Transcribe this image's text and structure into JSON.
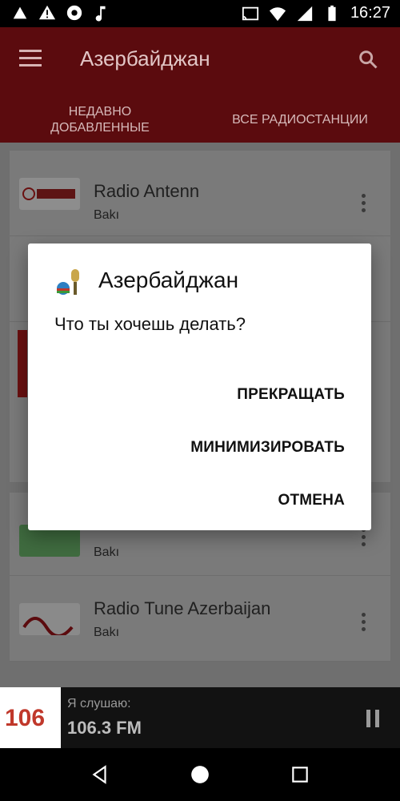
{
  "status_bar": {
    "time": "16:27",
    "icons": [
      "app-icon",
      "warning-icon",
      "aperture-icon",
      "music-note-icon",
      "cast-icon",
      "wifi-icon",
      "signal-icon",
      "battery-icon"
    ]
  },
  "app_bar": {
    "title": "Азербайджан",
    "menu_icon": "menu-icon",
    "search_icon": "search-icon",
    "colors": {
      "primary": "#5b0b0e",
      "indicator": "#7a6a1c"
    }
  },
  "tabs": [
    {
      "label": "НЕДАВНО ДОБАВЛЕННЫЕ",
      "selected": true
    },
    {
      "label": "ВСЕ РАДИОСТАНЦИИ",
      "selected": false
    }
  ],
  "stations": [
    {
      "name": "Radio Antenn",
      "city": "Bakı",
      "logo_text": "radio antenn"
    },
    {
      "name": "",
      "city": "",
      "logo_text": ""
    },
    {
      "name": "",
      "city": "",
      "logo_text": ""
    },
    {
      "name": "",
      "city": "Bakı",
      "logo_text": "YBF"
    },
    {
      "name": "Radio Tune Azerbaijan",
      "city": "Bakı",
      "logo_text": "RADIO tune"
    }
  ],
  "player": {
    "label": "Я слушаю:",
    "station": "106.3 FM",
    "logo_text": "106"
  },
  "dialog": {
    "title": "Азербайджан",
    "message": "Что ты хочешь делать?",
    "buttons": {
      "stop": "ПРЕКРАЩАТЬ",
      "minimize": "МИНИМИЗИРОВАТЬ",
      "cancel": "ОТМЕНА"
    }
  },
  "nav_bar": {
    "back_icon": "back-icon",
    "home_icon": "home-icon",
    "recents_icon": "recents-icon"
  }
}
